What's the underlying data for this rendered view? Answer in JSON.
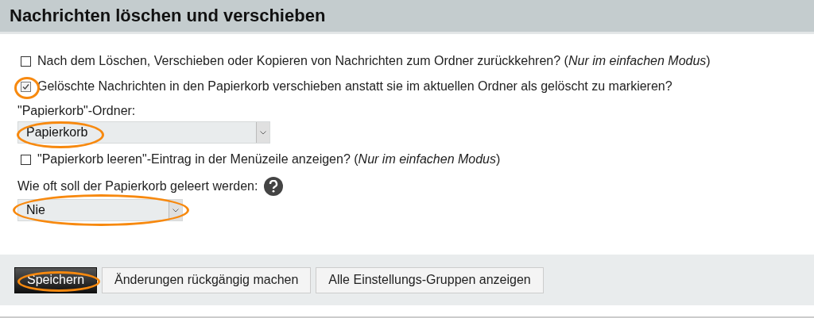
{
  "title": "Nachrichten löschen und verschieben",
  "fields": [
    {
      "kind": "checkbox",
      "label": "Nach dem Löschen, Verschieben oder Kopieren von Nachrichten zum Ordner zurückkehren? (*Nur im einfachen Modus*)",
      "checked": false,
      "highlighted": false
    },
    {
      "kind": "checkbox",
      "label": "Gelöschte Nachrichten in den Papierkorb verschieben anstatt sie im aktuellen Ordner als gelöscht zu markieren?",
      "checked": true,
      "highlighted": true
    },
    {
      "kind": "select",
      "label": "\"Papierkorb\"-Ordner:",
      "value": "Papierkorb",
      "help": false,
      "highlighted": true
    },
    {
      "kind": "checkbox",
      "label": "\"Papierkorb leeren\"-Eintrag in der Menüzeile anzeigen? (*Nur im einfachen Modus*)",
      "checked": false,
      "highlighted": false
    },
    {
      "kind": "select",
      "label": "Wie oft soll der Papierkorb geleert werden:",
      "value": "Nie",
      "help": true,
      "highlighted": true
    }
  ],
  "buttons": [
    {
      "label": "Speichern",
      "primary": true,
      "highlighted": true
    },
    {
      "label": "Änderungen rückgängig machen",
      "primary": false,
      "highlighted": false
    },
    {
      "label": "Alle Einstellungs-Gruppen anzeigen",
      "primary": false,
      "highlighted": false
    }
  ]
}
